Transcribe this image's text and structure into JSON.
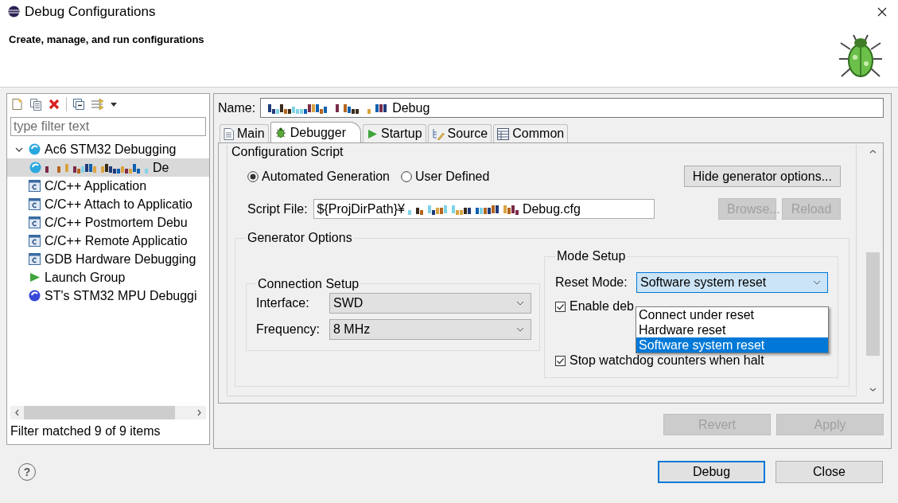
{
  "window": {
    "title": "Debug Configurations"
  },
  "banner": {
    "message": "Create, manage, and run configurations"
  },
  "tree_panel": {
    "filter": {
      "placeholder": "type filter text"
    },
    "items": [
      {
        "label": "Ac6 STM32 Debugging",
        "kind": "ac6",
        "selected": false,
        "expanded": true,
        "children": [
          {
            "label": "De",
            "kind": "ac6",
            "selected": true
          }
        ]
      },
      {
        "label": "C/C++ Application",
        "kind": "c-app",
        "selected": false
      },
      {
        "label": "C/C++ Attach to Applicatio",
        "kind": "c-app",
        "selected": false
      },
      {
        "label": "C/C++ Postmortem Debu",
        "kind": "c-app",
        "selected": false
      },
      {
        "label": "C/C++ Remote Applicatio",
        "kind": "c-app",
        "selected": false
      },
      {
        "label": "GDB Hardware Debugging",
        "kind": "c-app",
        "selected": false
      },
      {
        "label": "Launch Group",
        "kind": "launch",
        "selected": false
      },
      {
        "label": "ST's STM32 MPU Debuggi",
        "kind": "mpu",
        "selected": false
      }
    ],
    "status": "Filter matched 9 of 9 items"
  },
  "editor": {
    "name": {
      "label": "Name:",
      "value": "Debug"
    },
    "tabs": [
      {
        "label": "Main",
        "kind": "page",
        "selected": false
      },
      {
        "label": "Debugger",
        "kind": "bug",
        "selected": true
      },
      {
        "label": "Startup",
        "kind": "play",
        "selected": false
      },
      {
        "label": "Source",
        "kind": "source",
        "selected": false
      },
      {
        "label": "Common",
        "kind": "table",
        "selected": false
      }
    ],
    "script": {
      "title": "Configuration Script",
      "modes": [
        {
          "label": "Automated Generation",
          "selected": true
        },
        {
          "label": "User Defined",
          "selected": false
        }
      ],
      "toggle_button": {
        "label": "Hide generator options...",
        "disabled": false
      },
      "file": {
        "label": "Script File:",
        "prefix": "${ProjDirPath}¥",
        "suffix": "Debug.cfg"
      },
      "buttons": [
        {
          "label": "Browse...",
          "disabled": true
        },
        {
          "label": "Reload",
          "disabled": true
        }
      ]
    },
    "generator": {
      "title": "Generator Options",
      "connection": {
        "title": "Connection Setup",
        "fields": [
          {
            "label": "Interface:",
            "value": "SWD"
          },
          {
            "label": "Frequency:",
            "value": "8 MHz"
          }
        ]
      },
      "mode": {
        "title": "Mode Setup",
        "reset": {
          "label": "Reset Mode:",
          "value": "Software system reset",
          "open": true,
          "options": [
            {
              "label": "Connect under reset",
              "selected": false
            },
            {
              "label": "Hardware reset",
              "selected": false
            },
            {
              "label": "Software system reset",
              "selected": true
            }
          ]
        },
        "options": [
          {
            "label": "Enable deb",
            "checked": true
          },
          {
            "label": "Stop watchdog counters when halt",
            "checked": true
          }
        ]
      }
    },
    "buttons": [
      {
        "label": "Revert",
        "disabled": true
      },
      {
        "label": "Apply",
        "disabled": true
      }
    ]
  },
  "footer": {
    "help": "?",
    "buttons": [
      {
        "label": "Debug",
        "default": true
      },
      {
        "label": "Close",
        "default": false
      }
    ]
  }
}
